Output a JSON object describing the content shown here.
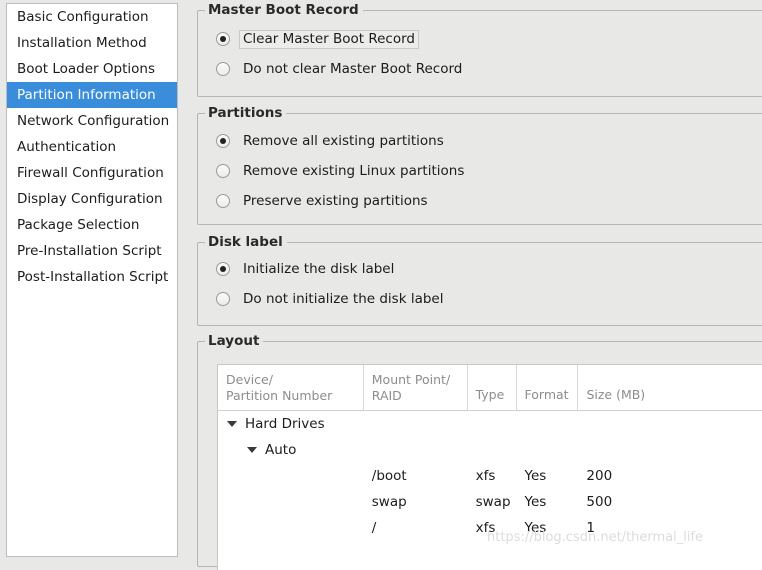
{
  "sidebar": {
    "items": [
      {
        "label": "Basic Configuration",
        "selected": false
      },
      {
        "label": "Installation Method",
        "selected": false
      },
      {
        "label": "Boot Loader Options",
        "selected": false
      },
      {
        "label": "Partition Information",
        "selected": true
      },
      {
        "label": "Network Configuration",
        "selected": false
      },
      {
        "label": "Authentication",
        "selected": false
      },
      {
        "label": "Firewall Configuration",
        "selected": false
      },
      {
        "label": "Display Configuration",
        "selected": false
      },
      {
        "label": "Package Selection",
        "selected": false
      },
      {
        "label": "Pre-Installation Script",
        "selected": false
      },
      {
        "label": "Post-Installation Script",
        "selected": false
      }
    ],
    "selected_color": "#3a8ddb"
  },
  "groups": {
    "mbr": {
      "title": "Master Boot Record",
      "options": [
        {
          "label": "Clear Master Boot Record",
          "checked": true,
          "focused": true
        },
        {
          "label": "Do not clear Master Boot Record",
          "checked": false,
          "focused": false
        }
      ]
    },
    "partitions": {
      "title": "Partitions",
      "options": [
        {
          "label": "Remove all existing partitions",
          "checked": true,
          "focused": false
        },
        {
          "label": "Remove existing Linux partitions",
          "checked": false,
          "focused": false
        },
        {
          "label": "Preserve existing partitions",
          "checked": false,
          "focused": false
        }
      ]
    },
    "disk_label": {
      "title": "Disk label",
      "options": [
        {
          "label": "Initialize the disk label",
          "checked": true,
          "focused": false
        },
        {
          "label": "Do not initialize the disk label",
          "checked": false,
          "focused": false
        }
      ]
    },
    "layout": {
      "title": "Layout",
      "table": {
        "columns": [
          "Device/\nPartition Number",
          "Mount Point/\nRAID",
          "Type",
          "Format",
          "Size (MB)"
        ],
        "tree": [
          {
            "indent": 0,
            "expander": "down-triangle",
            "label": "Hard Drives"
          },
          {
            "indent": 1,
            "expander": "down-triangle",
            "label": "Auto"
          }
        ],
        "rows": [
          {
            "device": "",
            "mount": "/boot",
            "type": "xfs",
            "format": "Yes",
            "size": "200"
          },
          {
            "device": "",
            "mount": "swap",
            "type": "swap",
            "format": "Yes",
            "size": "500"
          },
          {
            "device": "",
            "mount": "/",
            "type": "xfs",
            "format": "Yes",
            "size": "1"
          }
        ]
      }
    }
  },
  "watermark": {
    "text": "https://blog.csdn.net/thermal_life"
  }
}
